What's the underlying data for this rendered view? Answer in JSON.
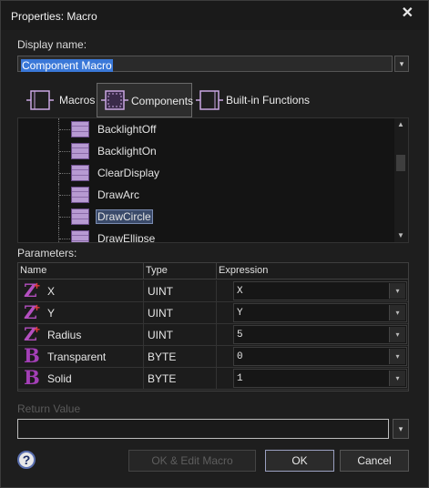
{
  "window": {
    "title": "Properties: Macro",
    "close_glyph": "✕"
  },
  "display_name": {
    "label": "Display name:",
    "value": "Component Macro",
    "dropdown_glyph": "▾"
  },
  "tabs": [
    {
      "label": "Macros",
      "icon": "macro-icon",
      "active": false
    },
    {
      "label": "Components",
      "icon": "component-icon",
      "active": true
    },
    {
      "label": "Built-in Functions",
      "icon": "function-icon",
      "active": false
    }
  ],
  "tree": {
    "items": [
      {
        "label": "BacklightOff",
        "selected": false
      },
      {
        "label": "BacklightOn",
        "selected": false
      },
      {
        "label": "ClearDisplay",
        "selected": false
      },
      {
        "label": "DrawArc",
        "selected": false
      },
      {
        "label": "DrawCircle",
        "selected": true
      },
      {
        "label": "DrawEllipse",
        "selected": false
      }
    ],
    "scroll_up": "▲",
    "scroll_down": "▼"
  },
  "parameters": {
    "label": "Parameters:",
    "headers": [
      "Name",
      "Type",
      "Expression"
    ],
    "rows": [
      {
        "icon": "Z",
        "name": "X",
        "type": "UINT",
        "expression": "X"
      },
      {
        "icon": "Z",
        "name": "Y",
        "type": "UINT",
        "expression": "Y"
      },
      {
        "icon": "Z",
        "name": "Radius",
        "type": "UINT",
        "expression": "5"
      },
      {
        "icon": "B",
        "name": "Transparent",
        "type": "BYTE",
        "expression": "0"
      },
      {
        "icon": "B",
        "name": "Solid",
        "type": "BYTE",
        "expression": "1"
      }
    ],
    "dropdown_glyph": "▾",
    "plus_glyph": "+"
  },
  "return_value": {
    "label": "Return Value",
    "value": "",
    "dropdown_glyph": "▾"
  },
  "buttons": {
    "help": "?",
    "ok_edit": "OK & Edit Macro",
    "ok": "OK",
    "cancel": "Cancel"
  },
  "colors": {
    "accent_selection": "#3a78d8",
    "icon_purple": "#b44fc0",
    "icon_plus": "#e03a3a"
  }
}
